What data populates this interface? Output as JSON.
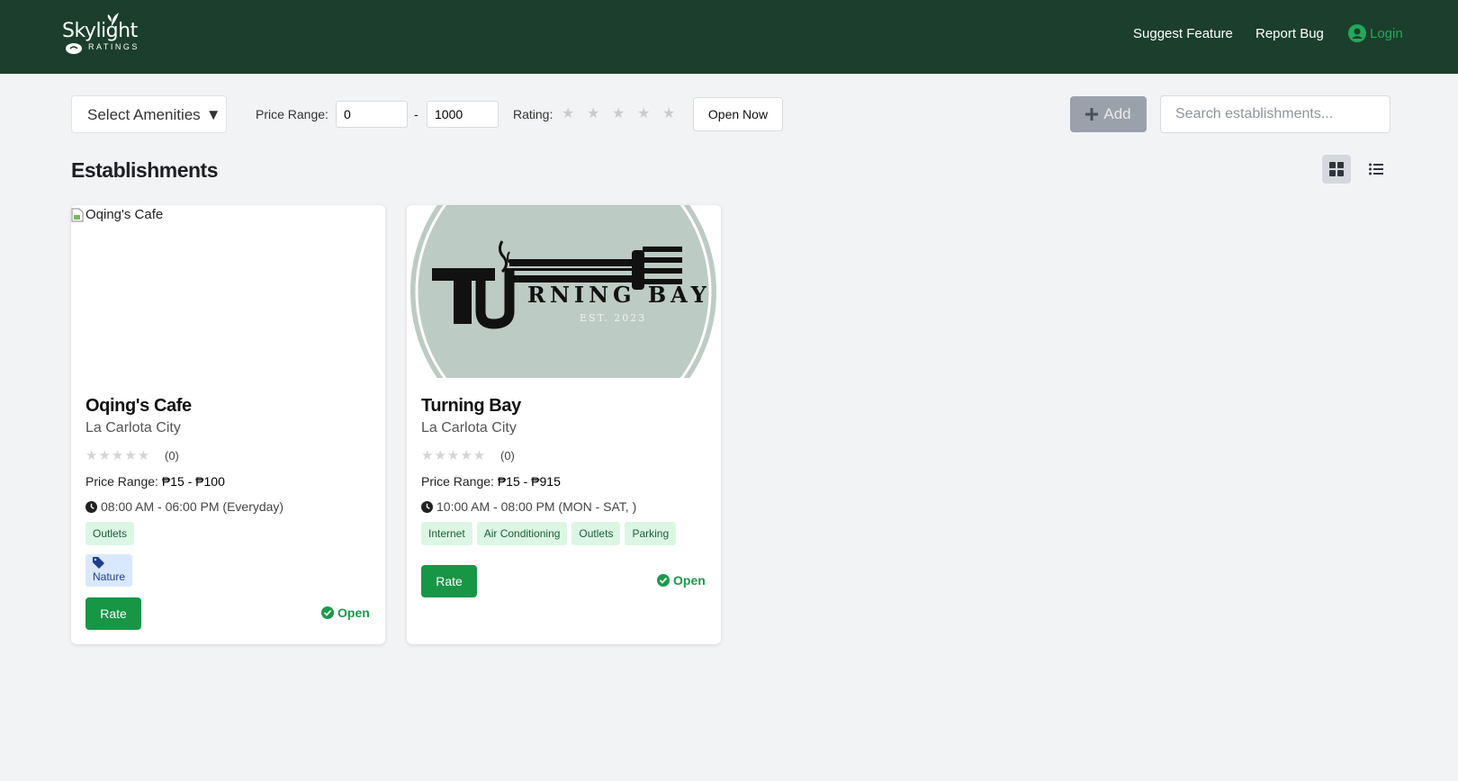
{
  "header": {
    "logo_title": "Skylight",
    "logo_subtitle": "RATINGS",
    "nav": {
      "suggest": "Suggest Feature",
      "report": "Report Bug",
      "login": "Login"
    },
    "colors": {
      "background": "#1b3f2c",
      "login": "#22a95a"
    }
  },
  "filters": {
    "amenities_label": "Select Amenities",
    "amenities_icon": "triangle-down-icon",
    "price_label": "Price Range:",
    "price_min": "0",
    "price_separator": "-",
    "price_max": "1000",
    "rating_label": "Rating:",
    "rating_star": "★",
    "open_now_label": "Open Now",
    "add_label": "Add",
    "add_icon": "plus-icon",
    "search_placeholder": "Search establishments..."
  },
  "main": {
    "title": "Establishments",
    "view_modes": [
      "grid-view-icon",
      "list-view-icon"
    ],
    "active_view": "grid"
  },
  "establishments": [
    {
      "name": "Oqing's Cafe",
      "image_alt": "Oqing's Cafe",
      "city": "La Carlota City",
      "stars": "★★★★★",
      "rating": 0,
      "review_count": "(0)",
      "price_label": "Price Range:",
      "price_value": "₱15 - ₱100",
      "hours": "08:00 AM - 06:00 PM (Everyday)",
      "amenities": [
        "Outlets"
      ],
      "category": "Nature",
      "rate_label": "Rate",
      "status": "Open"
    },
    {
      "name": "Turning Bay",
      "image_alt": "Turning Bay",
      "logo_text": "RNING BAY",
      "logo_est": "EST. 2023",
      "city": "La Carlota City",
      "stars": "★★★★★",
      "rating": 0,
      "review_count": "(0)",
      "price_label": "Price Range:",
      "price_value": "₱15 - ₱915",
      "hours": "10:00 AM - 08:00 PM (MON - SAT, )",
      "amenities": [
        "Internet",
        "Air Conditioning",
        "Outlets",
        "Parking"
      ],
      "rate_label": "Rate",
      "status": "Open"
    }
  ]
}
